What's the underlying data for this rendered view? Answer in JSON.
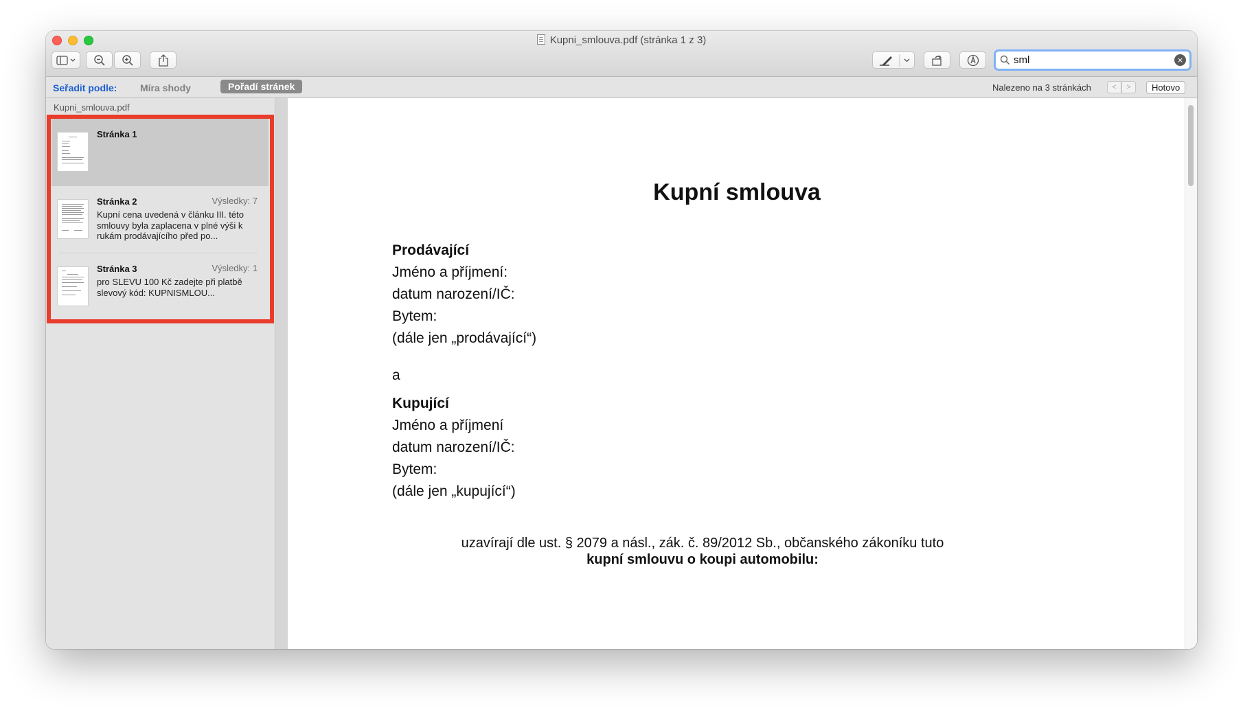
{
  "window": {
    "title": "Kupni_smlouva.pdf (stránka 1 z 3)"
  },
  "toolbar": {
    "buttons": [
      "sidebar-toggle-icon",
      "zoom-out-icon",
      "zoom-in-icon",
      "share-icon",
      "markup-pen-icon",
      "rotate-icon",
      "annotate-icon"
    ]
  },
  "search": {
    "value": "sml"
  },
  "findbar": {
    "sort_label": "Seřadit podle:",
    "sort_relevance": "Míra shody",
    "sort_page_order": "Pořadí stránek",
    "found_text": "Nalezeno na 3 stránkách",
    "prev": "<",
    "next": ">",
    "done": "Hotovo"
  },
  "sidebar": {
    "header": "Kupni_smlouva.pdf",
    "results": [
      {
        "page": "Stránka 1",
        "count": "",
        "snippet": ""
      },
      {
        "page": "Stránka 2",
        "count": "Výsledky: 7",
        "snippet": "Kupní cena uvedená v článku III. této smlouvy byla zaplacena v plné výši k rukám prodávajícího před po..."
      },
      {
        "page": "Stránka 3",
        "count": "Výsledky: 1",
        "snippet": "pro SLEVU 100 Kč zadejte při platbě slevový kód: KUPNISMLOU..."
      }
    ]
  },
  "document": {
    "title": "Kupní smlouva",
    "seller_heading": "Prodávající",
    "seller_name": "Jméno a příjmení:",
    "seller_birth": "datum narození/IČ:",
    "seller_address": "Bytem:",
    "seller_ref": "(dále jen „prodávající“)",
    "and": "a",
    "buyer_heading": "Kupující",
    "buyer_name": "Jméno a příjmení",
    "buyer_birth": "datum narození/IČ:",
    "buyer_address": "Bytem:",
    "buyer_ref": "(dále jen „kupující“)",
    "closing_line1": "uzavírají dle ust. § 2079 a násl., zák. č. 89/2012 Sb., občanského zákoníku tuto",
    "closing_line2": "kupní smlouvu o koupi automobilu:"
  },
  "colors": {
    "highlight_border": "#e93c2a",
    "sort_label": "#1c5fd1",
    "search_focus": "#7fb2f5"
  }
}
